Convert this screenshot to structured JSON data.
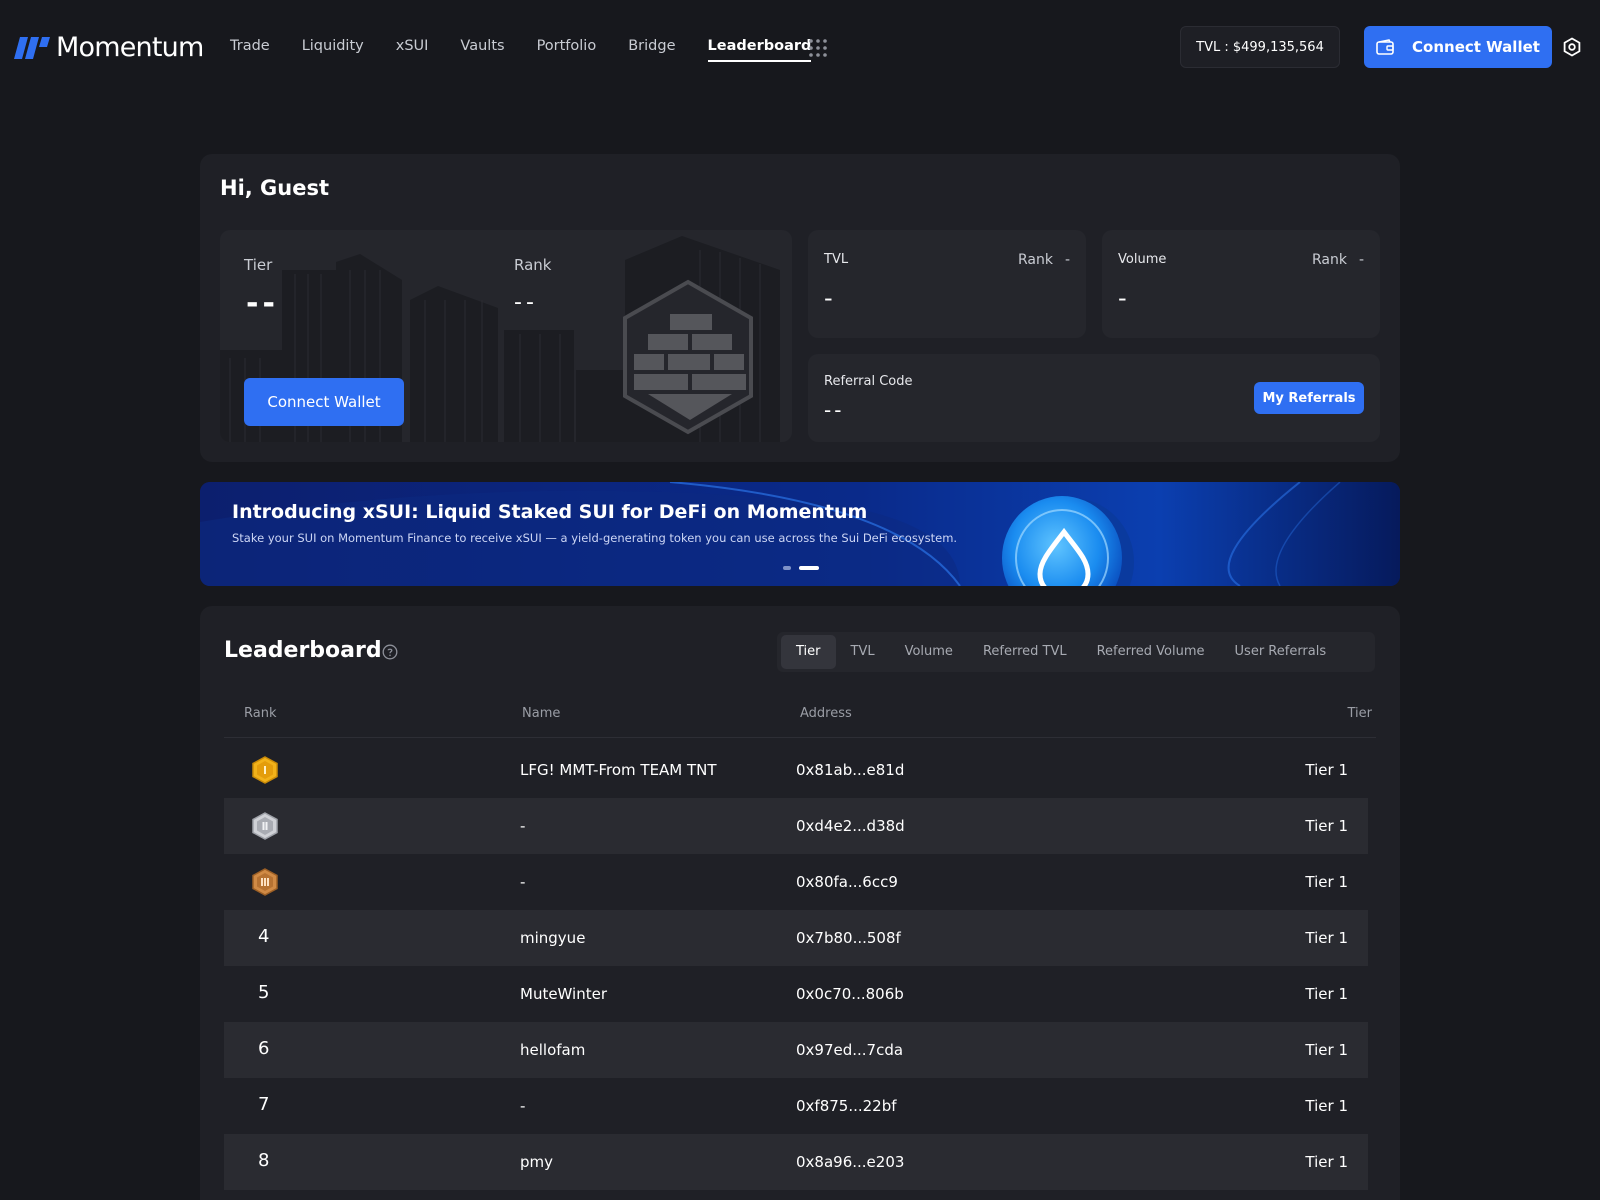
{
  "header": {
    "logo_text": "Momentum",
    "nav": [
      "Trade",
      "Liquidity",
      "xSUI",
      "Vaults",
      "Portfolio",
      "Bridge",
      "Leaderboard"
    ],
    "active_nav": "Leaderboard",
    "tvl": "TVL : $499,135,564",
    "connect_label": "Connect Wallet",
    "accent": "#2f6ff2"
  },
  "profile": {
    "greeting": "Hi, Guest",
    "tier_label": "Tier",
    "tier_value": "--",
    "rank_label": "Rank",
    "rank_value": "--",
    "connect_label": "Connect Wallet",
    "tvl_card": {
      "label": "TVL",
      "rank_label": "Rank",
      "rank_value": "-",
      "value": "-"
    },
    "volume_card": {
      "label": "Volume",
      "rank_label": "Rank",
      "rank_value": "-",
      "value": "-"
    },
    "referral": {
      "label": "Referral Code",
      "value": "--",
      "button": "My Referrals"
    }
  },
  "banner": {
    "title": "Introducing xSUI: Liquid Staked SUI for DeFi on Momentum",
    "subtitle": "Stake your SUI on Momentum Finance to receive xSUI — a yield-generating token you can use across the Sui DeFi ecosystem.",
    "slides": 2,
    "active_slide": 2
  },
  "leaderboard": {
    "title": "Leaderboard",
    "tabs": [
      "Tier",
      "TVL",
      "Volume",
      "Referred TVL",
      "Referred Volume",
      "User Referrals"
    ],
    "active_tab": "Tier",
    "columns": {
      "rank": "Rank",
      "name": "Name",
      "address": "Address",
      "tier": "Tier"
    },
    "rows": [
      {
        "rank": "1",
        "medal": "gold",
        "name": "LFG! MMT-From TEAM TNT",
        "address": "0x81ab...e81d",
        "tier": "Tier 1"
      },
      {
        "rank": "2",
        "medal": "silver",
        "name": "-",
        "address": "0xd4e2...d38d",
        "tier": "Tier 1"
      },
      {
        "rank": "3",
        "medal": "bronze",
        "name": "-",
        "address": "0x80fa...6cc9",
        "tier": "Tier 1"
      },
      {
        "rank": "4",
        "name": "mingyue",
        "address": "0x7b80...508f",
        "tier": "Tier 1"
      },
      {
        "rank": "5",
        "name": "MuteWinter",
        "address": "0x0c70...806b",
        "tier": "Tier 1"
      },
      {
        "rank": "6",
        "name": "hellofam",
        "address": "0x97ed...7cda",
        "tier": "Tier 1"
      },
      {
        "rank": "7",
        "name": "-",
        "address": "0xf875...22bf",
        "tier": "Tier 1"
      },
      {
        "rank": "8",
        "name": "pmy",
        "address": "0x8a96...e203",
        "tier": "Tier 1"
      }
    ]
  }
}
